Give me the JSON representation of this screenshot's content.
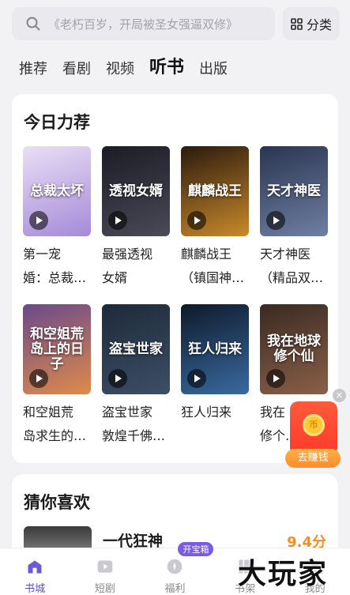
{
  "search": {
    "placeholder": "《老朽百岁，开局被圣女强逼双修》"
  },
  "category_button": {
    "label": "分类",
    "icon": "grid-icon"
  },
  "tabs": [
    {
      "label": "推荐",
      "active": false
    },
    {
      "label": "看剧",
      "active": false
    },
    {
      "label": "视频",
      "active": false
    },
    {
      "label": "听书",
      "active": true
    },
    {
      "label": "出版",
      "active": false
    }
  ],
  "today_section": {
    "title": "今日力荐",
    "books": [
      {
        "name_line1": "第一宠",
        "name_line2": "婚：总裁…",
        "cover_text": "总裁太坏",
        "colors": [
          "#e9dff5",
          "#a58ad8"
        ]
      },
      {
        "name_line1": "最强透视",
        "name_line2": "女婿",
        "cover_text": "透视女婿",
        "colors": [
          "#1c1c26",
          "#4a4a58"
        ]
      },
      {
        "name_line1": "麒麟战王",
        "name_line2": "（镇国神…",
        "cover_text": "麒麟战王",
        "colors": [
          "#2b1a0e",
          "#c98a2a"
        ]
      },
      {
        "name_line1": "天才神医",
        "name_line2": "（精品双…",
        "cover_text": "天才神医",
        "colors": [
          "#2a3550",
          "#6f7fa3"
        ]
      },
      {
        "name_line1": "和空姐荒",
        "name_line2": "岛求生的…",
        "cover_text": "和空姐荒岛上的日子",
        "colors": [
          "#6a4a8a",
          "#e08a4a"
        ]
      },
      {
        "name_line1": "盗宝世家",
        "name_line2": "敦煌千佛…",
        "cover_text": "盗宝世家",
        "colors": [
          "#1e2a3a",
          "#3d4e66"
        ]
      },
      {
        "name_line1": "狂人归来",
        "name_line2": "",
        "cover_text": "狂人归来",
        "colors": [
          "#0e1a2a",
          "#3a6aa0"
        ]
      },
      {
        "name_line1": "我在",
        "name_line2": "修个…",
        "cover_text": "我在地球修个仙",
        "colors": [
          "#3a2a22",
          "#8a6048"
        ]
      }
    ]
  },
  "float_earn": {
    "label": "去赚钱",
    "coin_text": "币",
    "close": "×"
  },
  "guess_section": {
    "title": "猜你喜欢",
    "first_item": {
      "name": "一代狂神",
      "score": "9.4分"
    }
  },
  "bottom_nav": [
    {
      "label": "书城",
      "icon": "bookstore-icon",
      "active": true
    },
    {
      "label": "短剧",
      "icon": "play-video-icon",
      "active": false
    },
    {
      "label": "福利",
      "icon": "gift-icon",
      "active": false,
      "badge": "开宝箱"
    },
    {
      "label": "书架",
      "icon": "bookshelf-icon",
      "active": false
    },
    {
      "label": "我的",
      "icon": "profile-icon",
      "active": false
    }
  ],
  "watermark": "大玩家",
  "colors": {
    "accent": "#5a4fc9",
    "score": "#ff8a1e",
    "earn": "#ff4a32"
  }
}
